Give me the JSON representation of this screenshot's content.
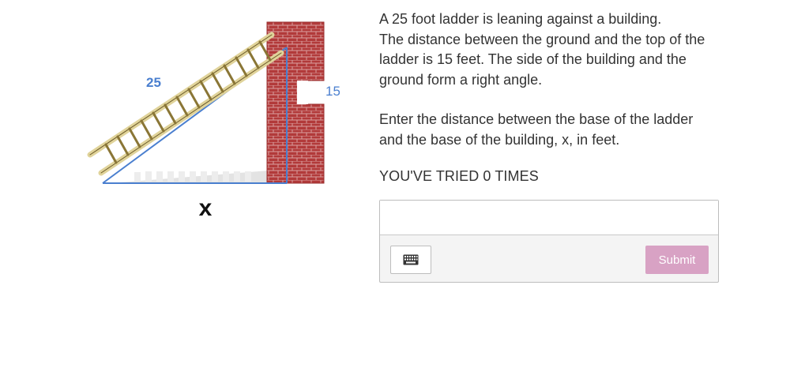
{
  "figure": {
    "ladder_label": "25",
    "height_label": "15",
    "base_label": "x",
    "colors": {
      "brick": "#b23a3a",
      "mortar": "#d9a0a0",
      "ladder": "#e0d39a",
      "line": "#4a7fcf"
    }
  },
  "question": {
    "paragraph1": [
      "A 25 foot ladder is leaning against a building.",
      "The distance between the ground and the top of the",
      "ladder is 15 feet. The side of the building and the",
      "ground form a right angle."
    ],
    "paragraph2": [
      "Enter the distance between the  base of the ladder",
      "and the base of the building, x, in feet."
    ],
    "tries": "YOU'VE TRIED 0 TIMES"
  },
  "answer": {
    "value": "",
    "placeholder": "",
    "keyboard_icon": "keyboard-icon",
    "submit_label": "Submit",
    "submit_color": "#d8a2c4"
  }
}
